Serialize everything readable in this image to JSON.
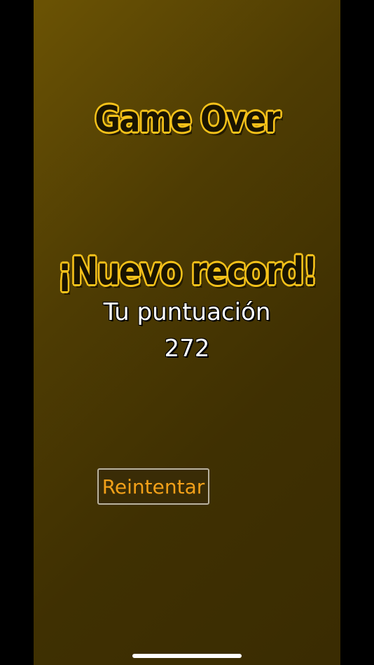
{
  "game_over": {
    "title": "Game Over",
    "record_message": "¡Nuevo record!",
    "score_label": "Tu puntuación",
    "score_value": "272",
    "retry_label": "Reintentar"
  },
  "colors": {
    "title_outline": "#f6c21a",
    "retry_text": "#f2a019",
    "background_top": "#6b5304",
    "background_bottom": "#3a2c02"
  }
}
